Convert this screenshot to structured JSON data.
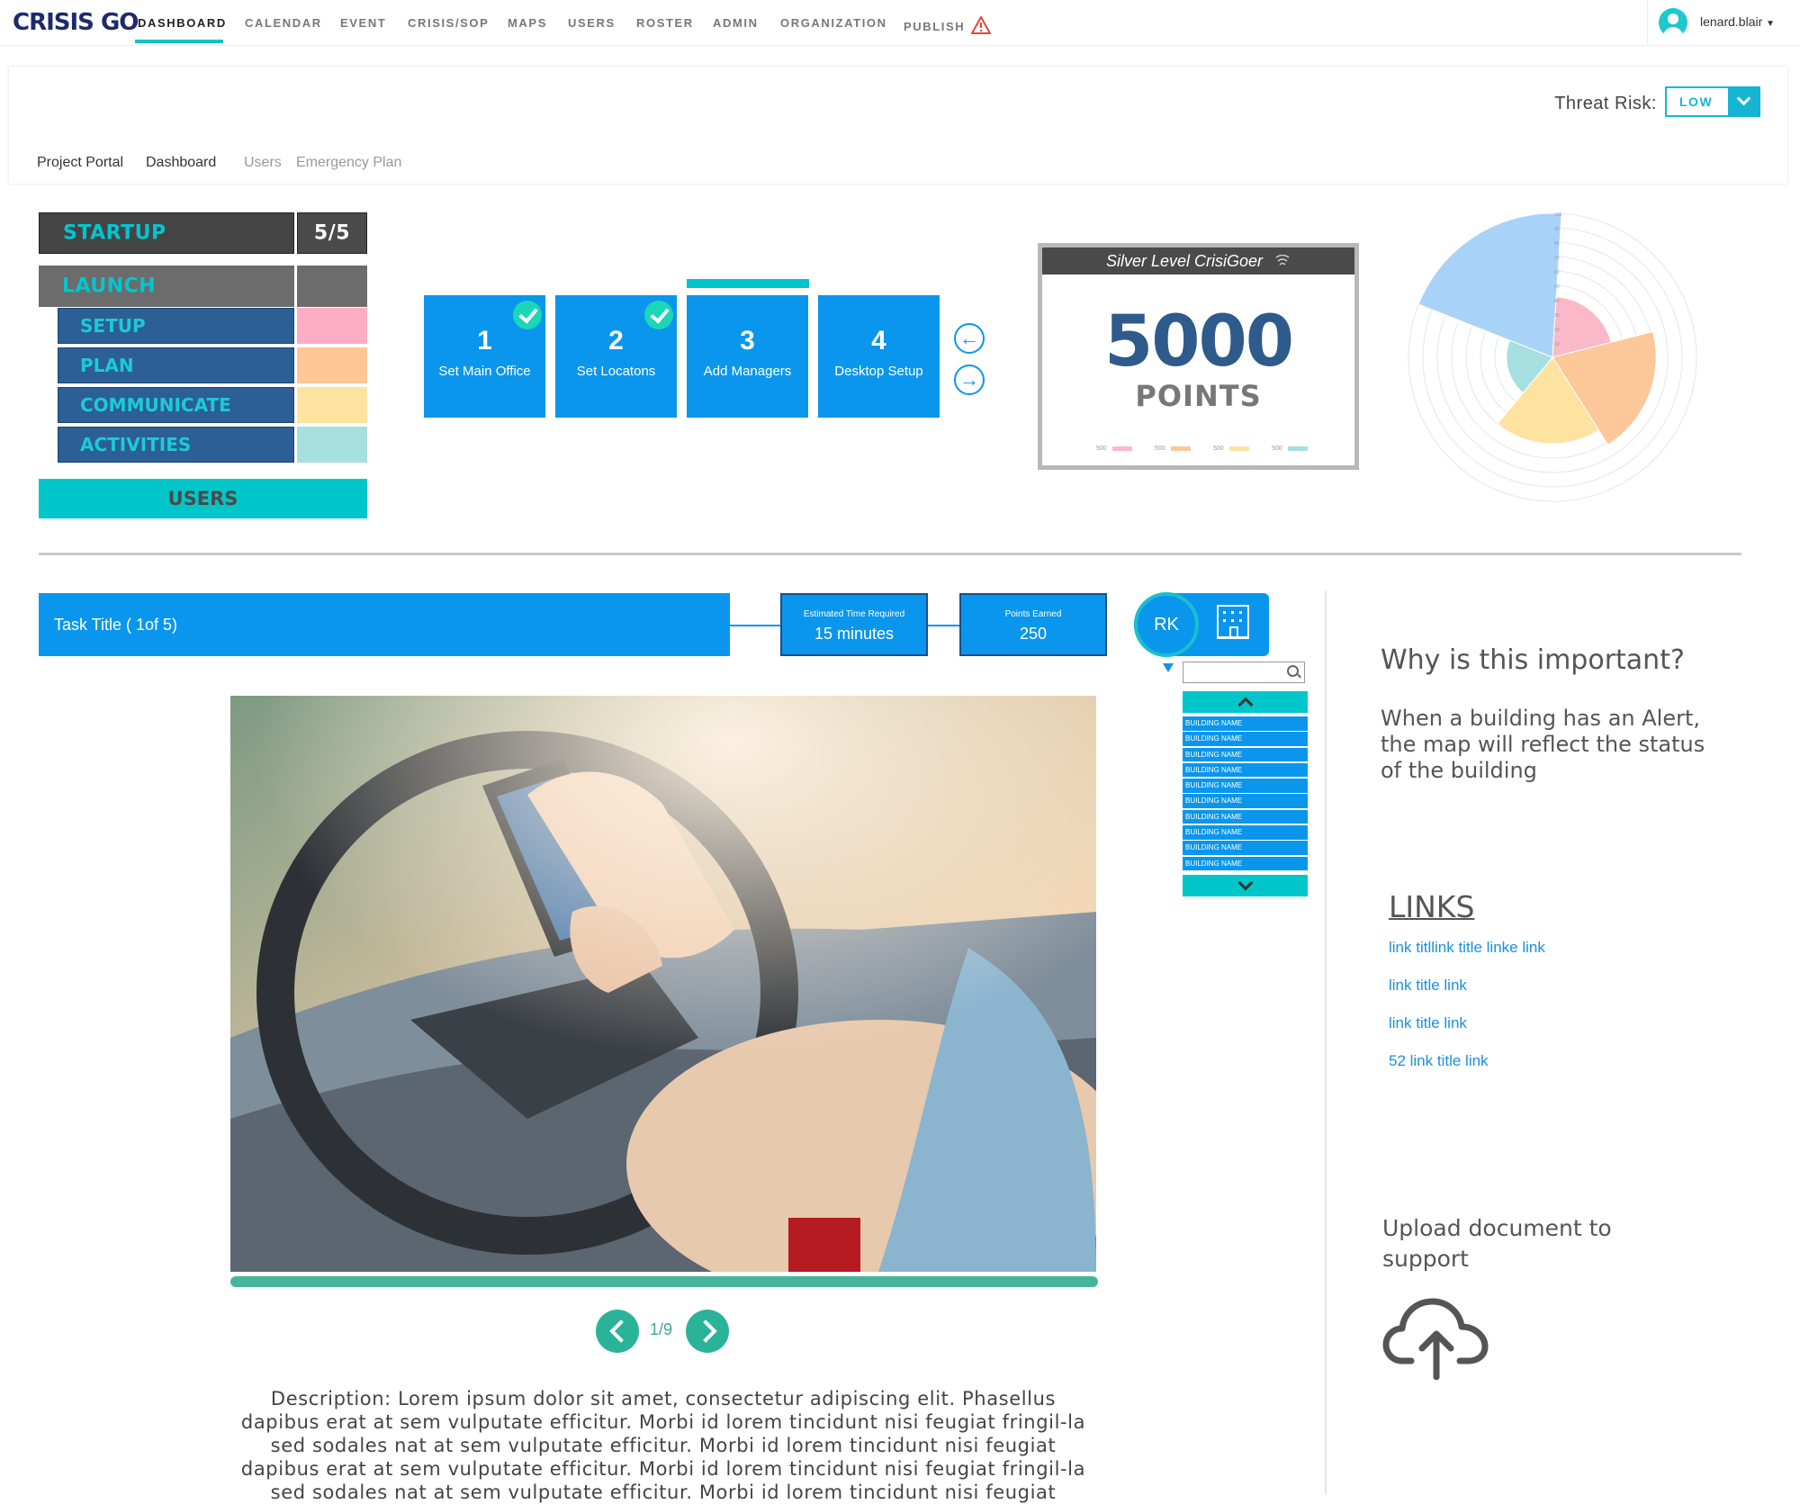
{
  "app": {
    "logo_part1": "CRISIS",
    "logo_part2": "GO"
  },
  "nav": {
    "items": [
      {
        "label": "DASHBOARD",
        "active": true
      },
      {
        "label": "CALENDAR"
      },
      {
        "label": "EVENT"
      },
      {
        "label": "CRISIS/SOP"
      },
      {
        "label": "MAPS"
      },
      {
        "label": "USERS"
      },
      {
        "label": "ROSTER"
      },
      {
        "label": "ADMIN"
      },
      {
        "label": "ORGANIZATION"
      },
      {
        "label": "PUBLISH"
      }
    ],
    "publish_icon": "warning-triangle-icon",
    "user": {
      "name": "lenard.blair",
      "icon": "user-avatar-icon"
    }
  },
  "header": {
    "threat_label": "Threat Risk:",
    "threat_value": "LOW",
    "breadcrumbs": [
      "Project Portal",
      "Dashboard",
      "Users",
      "Emergency Plan"
    ]
  },
  "stages": {
    "startup": {
      "label": "STARTUP",
      "count": "5/5"
    },
    "launch": {
      "label": "LAUNCH"
    },
    "substages": [
      {
        "label": "SETUP",
        "color": "#fcadc5"
      },
      {
        "label": "PLAN",
        "color": "#fdc795"
      },
      {
        "label": "COMMUNICATE",
        "color": "#fde3a0"
      },
      {
        "label": "ACTIVITIES",
        "color": "#a6dfe0"
      }
    ],
    "users": "USERS"
  },
  "steps": [
    {
      "num": "1",
      "label": "Set Main Office",
      "done": true
    },
    {
      "num": "2",
      "label": "Set Locatons",
      "done": true
    },
    {
      "num": "3",
      "label": "Add Managers",
      "done": false,
      "current": true
    },
    {
      "num": "4",
      "label": "Desktop Setup",
      "done": false
    }
  ],
  "points": {
    "level": "Silver Level CrisiGoer",
    "value": "5000",
    "label": "POINTS",
    "mini_legend": [
      "500",
      "500",
      "500",
      "500"
    ]
  },
  "chart_data": {
    "type": "polar-area",
    "ticks": [
      "100",
      "90",
      "80",
      "70",
      "60",
      "50",
      "40",
      "30",
      "20",
      "10"
    ],
    "rmax": 100,
    "slices": [
      {
        "value": 100,
        "color": "#a8d2f7"
      },
      {
        "value": 42,
        "color": "#fbb8c8"
      },
      {
        "value": 72,
        "color": "#fcc89a"
      },
      {
        "value": 60,
        "color": "#fde2a0"
      },
      {
        "value": 32,
        "color": "#a6dfe0"
      }
    ]
  },
  "task": {
    "title": "Task Title   ( 1of 5)",
    "time_label": "Estimated Time Required",
    "time_value": "15 minutes",
    "points_label": "Points Earned",
    "points_value": "250",
    "user_initials": "RK"
  },
  "buildings": [
    "BUILDING NAME",
    "BUILDING NAME",
    "BUILDING NAME",
    "BUILDING NAME",
    "BUILDING NAME",
    "BUILDING NAME",
    "BUILDING NAME",
    "BUILDING NAME",
    "BUILDING NAME",
    "BUILDING NAME"
  ],
  "slideshow": {
    "page": "1/9"
  },
  "description": "Description: Lorem ipsum dolor sit amet, consectetur adipiscing elit. Phasellus dapibus erat at sem vulputate efficitur. Morbi id lorem tincidunt nisi feugiat fringil-la sed sodales nat at sem vulputate efficitur. Morbi id lorem tincidunt nisi feugiat dapibus erat at sem vulputate efficitur. Morbi id lorem tincidunt nisi feugiat fringil-la sed sodales nat at sem vulputate efficitur. Morbi id lorem tincidunt nisi feugiat",
  "info": {
    "why_title": "Why is this important?",
    "why_body": "When a building has an Alert, the map will reflect the status of the building",
    "links_title": "LINKS",
    "links": [
      "link titllink title linke link",
      "link title link",
      "link title link",
      "52 link title link"
    ],
    "upload_title": "Upload document to support",
    "upload_icon": "cloud-upload-icon"
  }
}
